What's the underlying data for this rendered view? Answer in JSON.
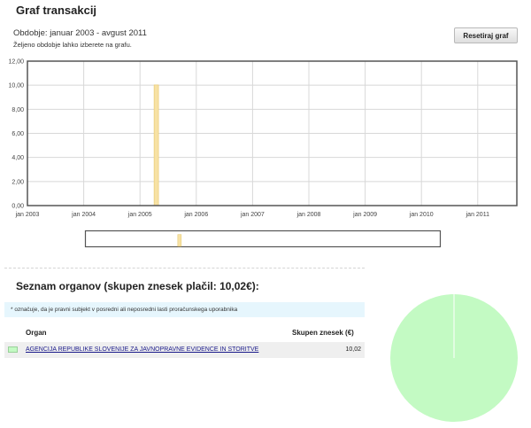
{
  "header": {
    "title": "Graf transakcij",
    "period": "Obdobje: januar 2003 - avgust 2011",
    "hint": "Željeno obdobje lahko izberete na grafu.",
    "reset_label": "Resetiraj graf"
  },
  "chart_data": {
    "type": "bar",
    "title": "",
    "xlabel": "",
    "ylabel": "",
    "ylim": [
      0,
      12
    ],
    "y_ticks": [
      "0,00",
      "2,00",
      "4,00",
      "6,00",
      "8,00",
      "10,00",
      "12,00"
    ],
    "x_ticks": [
      "jan 2003",
      "jan 2004",
      "jan 2005",
      "jan 2006",
      "jan 2007",
      "jan 2008",
      "jan 2009",
      "jan 2010",
      "jan 2011"
    ],
    "x_range": [
      "2003-01",
      "2011-08"
    ],
    "grid": true,
    "bar_color": "#f7e2a4",
    "bar_border": "#e6c66a",
    "series": [
      {
        "values": [
          {
            "x": "2005-04",
            "y": 10.02
          }
        ]
      }
    ]
  },
  "organs": {
    "title": "Seznam organov (skupen znesek plačil: 10,02€):",
    "note": "* označuje, da je pravni subjekt v posredni ali neposredni lasti proračunskega uporabnika",
    "col_organ": "Organ",
    "col_amount": "Skupen znesek (€)",
    "rows": [
      {
        "name": "AGENCIJA REPUBLIKE SLOVENIJE ZA JAVNOPRAVNE EVIDENCE IN STORITVE",
        "amount": "10,02",
        "color": "#c3fac3"
      }
    ]
  },
  "pie": {
    "slices": [
      {
        "label": "AGENCIJA REPUBLIKE SLOVENIJE ZA JAVNOPRAVNE EVIDENCE IN STORITVE",
        "value": 10.02,
        "color": "#c3fac3"
      }
    ]
  }
}
